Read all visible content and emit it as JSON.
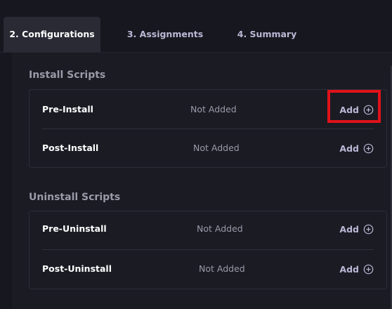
{
  "tabs": [
    {
      "label": "2. Configurations",
      "active": true
    },
    {
      "label": "3. Assignments",
      "active": false
    },
    {
      "label": "4. Summary",
      "active": false
    }
  ],
  "install": {
    "title": "Install Scripts",
    "rows": [
      {
        "label": "Pre-Install",
        "status": "Not Added",
        "action": "Add"
      },
      {
        "label": "Post-Install",
        "status": "Not Added",
        "action": "Add"
      }
    ]
  },
  "uninstall": {
    "title": "Uninstall Scripts",
    "rows": [
      {
        "label": "Pre-Uninstall",
        "status": "Not Added",
        "action": "Add"
      },
      {
        "label": "Post-Uninstall",
        "status": "Not Added",
        "action": "Add"
      }
    ]
  },
  "icons": {
    "add": "plus-circle-icon"
  },
  "colors": {
    "highlight": "#e01219",
    "background": "#17171f",
    "active_tab": "#2a2a35"
  }
}
